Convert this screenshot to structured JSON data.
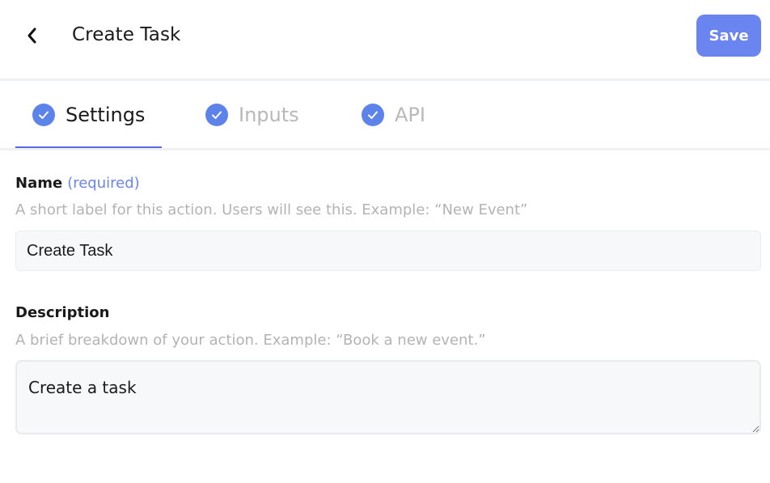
{
  "header": {
    "title": "Create Task",
    "save_label": "Save",
    "back_icon": "chevron-left-icon"
  },
  "tabs": [
    {
      "label": "Settings",
      "active": true,
      "icon": "check-circle-icon"
    },
    {
      "label": "Inputs",
      "active": false,
      "icon": "check-circle-icon"
    },
    {
      "label": "API",
      "active": false,
      "icon": "check-circle-icon"
    }
  ],
  "form": {
    "name": {
      "label": "Name",
      "required_text": "(required)",
      "help": "A short label for this action. Users will see this. Example: “New Event”",
      "value": "Create Task"
    },
    "description": {
      "label": "Description",
      "help": "A brief breakdown of your action. Example: “Book a new event.”",
      "value": "Create a task"
    }
  },
  "colors": {
    "accent": "#6a84f0",
    "check": "#5b83ea",
    "tab_underline": "#5b6ae0",
    "muted_text": "#b3b3b3",
    "input_bg": "#f7f8fa"
  }
}
